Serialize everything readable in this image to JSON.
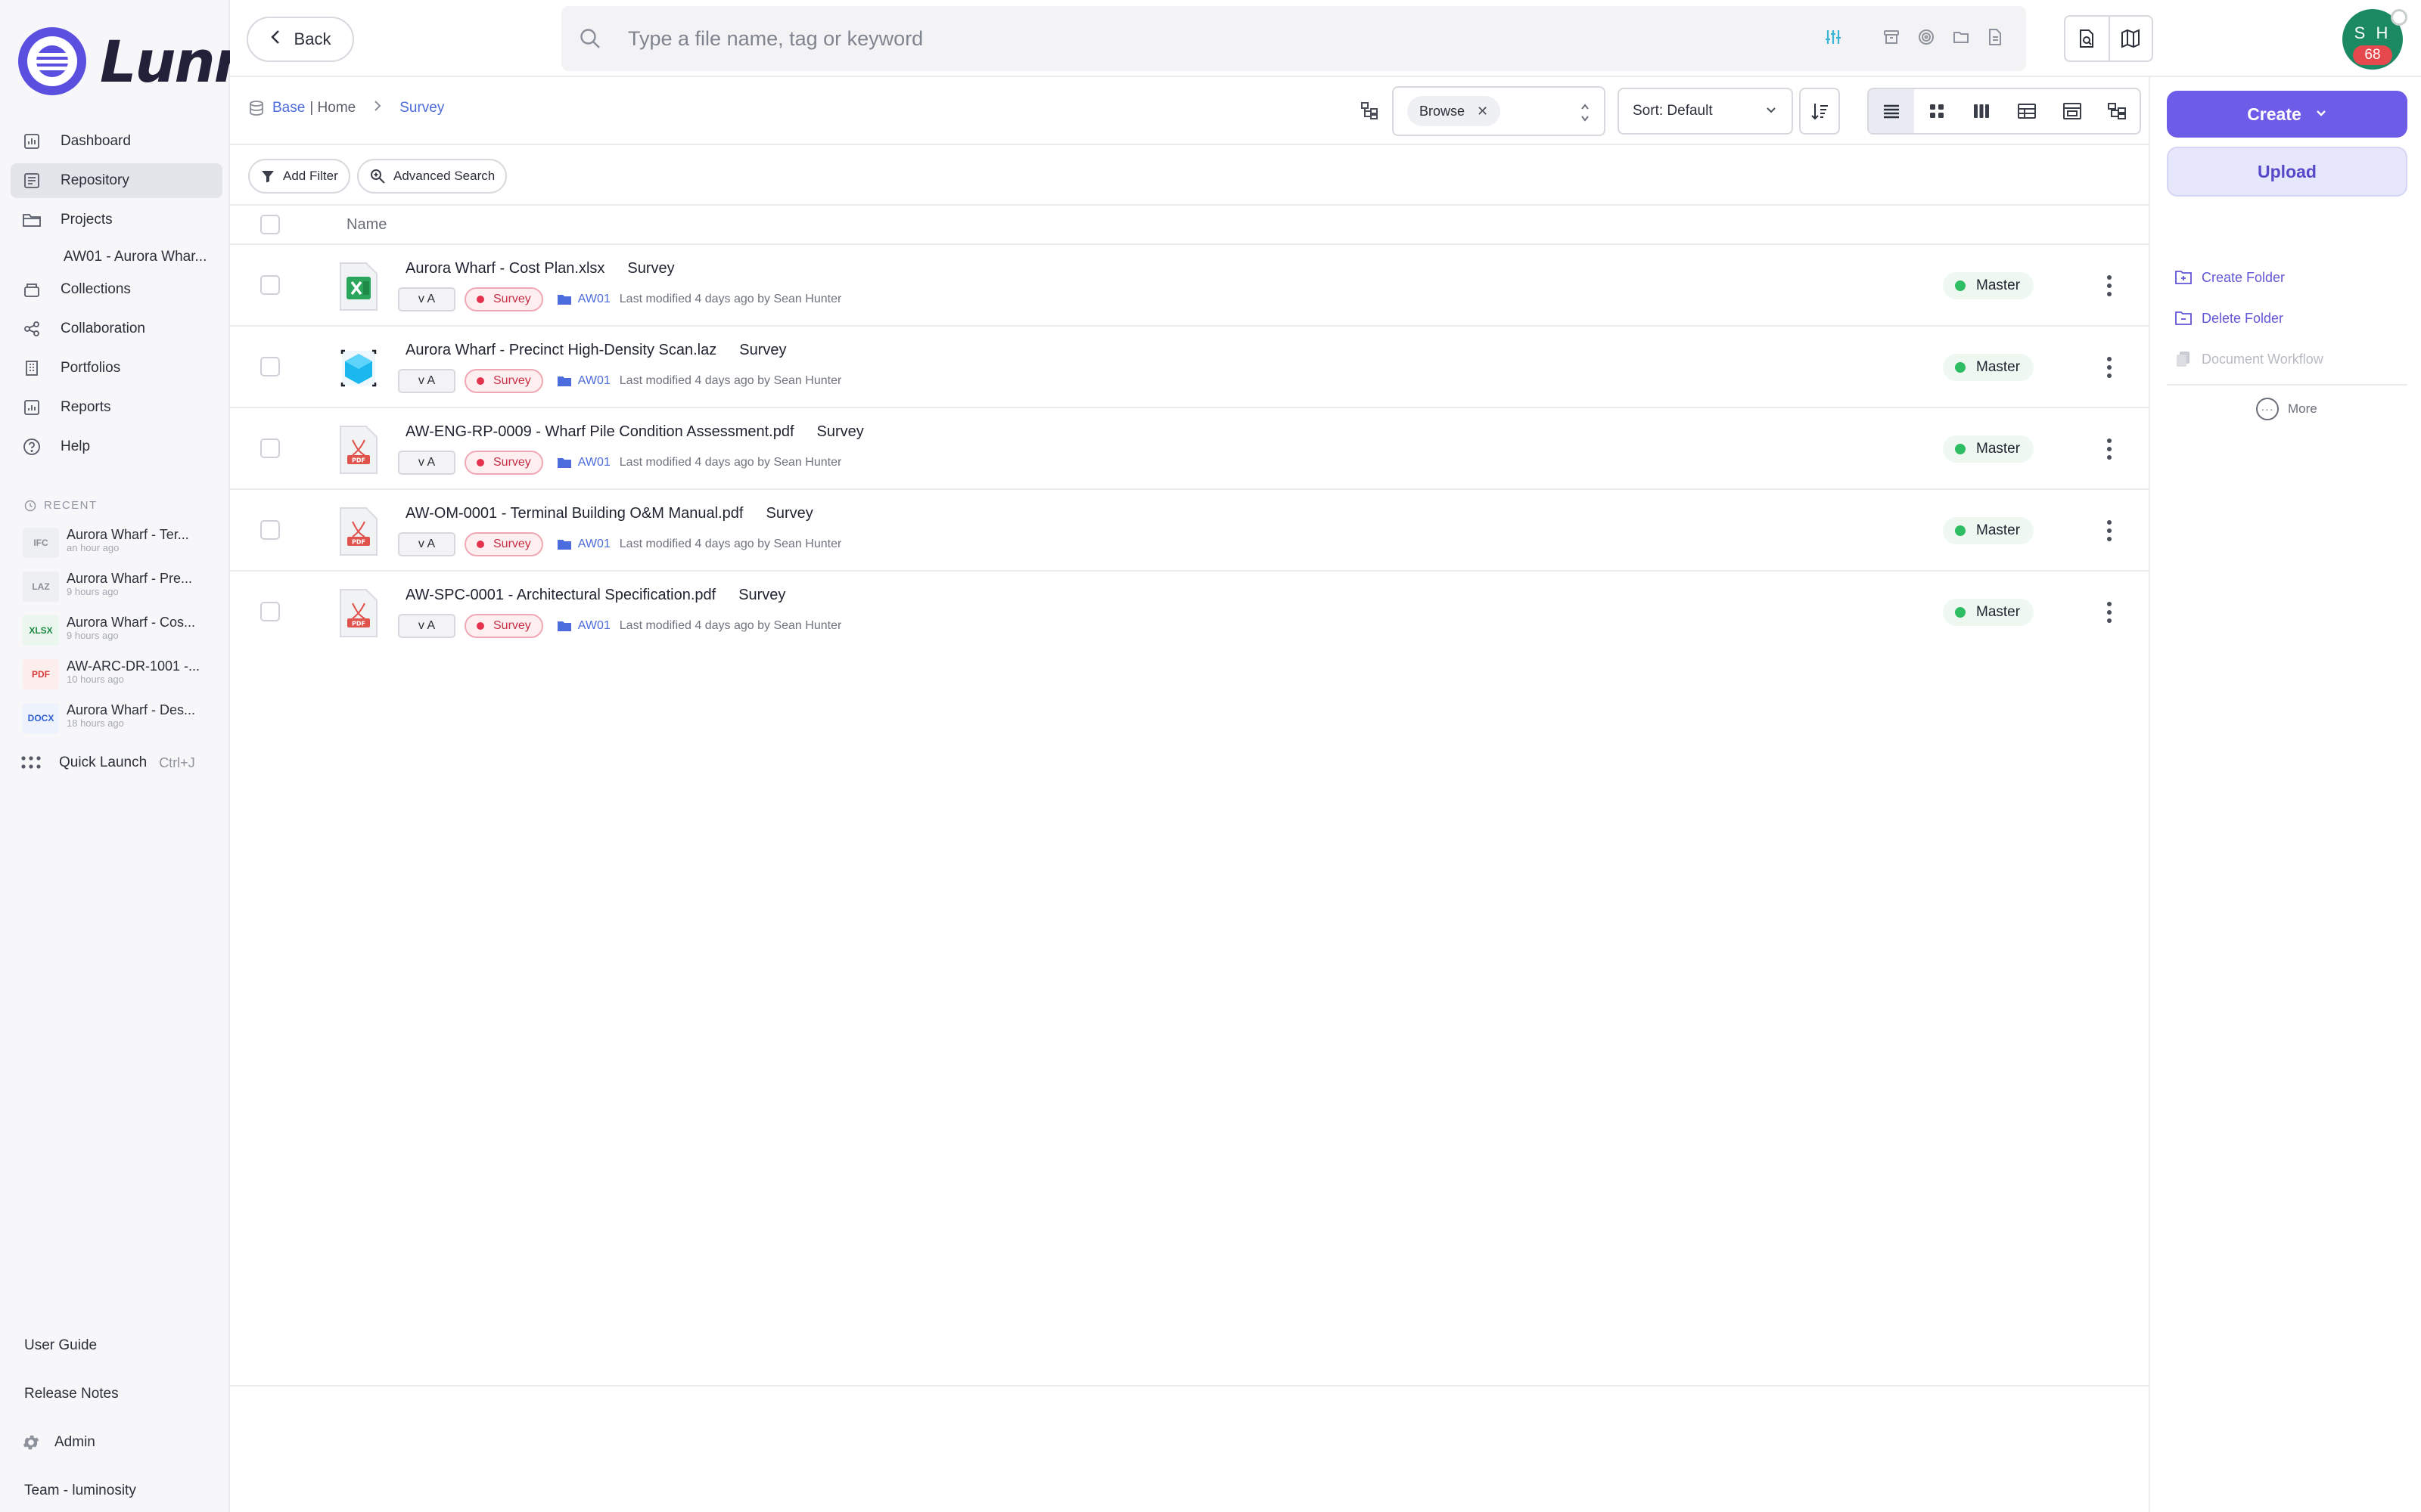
{
  "app": {
    "brand": "Lunr"
  },
  "sidebar": {
    "nav": [
      {
        "label": "Dashboard",
        "icon": "chart-icon"
      },
      {
        "label": "Repository",
        "icon": "repository-icon"
      },
      {
        "label": "Projects",
        "icon": "folder-icon"
      },
      {
        "label": "AW01 - Aurora Whar..."
      },
      {
        "label": "Collections",
        "icon": "collections-icon"
      },
      {
        "label": "Collaboration",
        "icon": "share-icon"
      },
      {
        "label": "Portfolios",
        "icon": "building-icon"
      },
      {
        "label": "Reports",
        "icon": "report-icon"
      },
      {
        "label": "Help",
        "icon": "help-icon"
      }
    ],
    "recent_label": "RECENT",
    "recent": [
      {
        "type": "IFC",
        "name": "Aurora Wharf - Ter...",
        "time": "an hour ago"
      },
      {
        "type": "LAZ",
        "name": "Aurora Wharf - Pre...",
        "time": "9 hours ago"
      },
      {
        "type": "XLSX",
        "name": "Aurora Wharf - Cos...",
        "time": "9 hours ago"
      },
      {
        "type": "PDF",
        "name": "AW-ARC-DR-1001 -...",
        "time": "10 hours ago"
      },
      {
        "type": "DOCX",
        "name": "Aurora Wharf - Des...",
        "time": "18 hours ago"
      }
    ],
    "quick_launch": {
      "label": "Quick Launch",
      "shortcut": "Ctrl+J"
    },
    "bottom": [
      {
        "label": "User Guide"
      },
      {
        "label": "Release Notes"
      },
      {
        "label": "Admin"
      },
      {
        "label": "Team - luminosity"
      }
    ]
  },
  "topbar": {
    "back_label": "Back",
    "search_placeholder": "Type a file name, tag or keyword",
    "avatar_initials": "S H",
    "avatar_badge": "68"
  },
  "toolbar": {
    "breadcrumb": {
      "base": "Base",
      "home": "| Home",
      "current": "Survey"
    },
    "browse_chip": "Browse",
    "sort_label": "Sort: Default"
  },
  "filters": {
    "add_filter": "Add Filter",
    "advanced_search": "Advanced Search"
  },
  "table": {
    "header_name": "Name",
    "rows": [
      {
        "name": "Aurora Wharf - Cost Plan.xlsx",
        "tag": "Survey",
        "version": "v A",
        "label": "Survey",
        "folder": "AW01",
        "modified": "Last modified 4 days ago by Sean Hunter",
        "status": "Master",
        "filetype": "xlsx"
      },
      {
        "name": "Aurora Wharf - Precinct High-Density Scan.laz",
        "tag": "Survey",
        "version": "v A",
        "label": "Survey",
        "folder": "AW01",
        "modified": "Last modified 4 days ago by Sean Hunter",
        "status": "Master",
        "filetype": "laz"
      },
      {
        "name": "AW-ENG-RP-0009 - Wharf Pile Condition Assessment.pdf",
        "tag": "Survey",
        "version": "v A",
        "label": "Survey",
        "folder": "AW01",
        "modified": "Last modified 4 days ago by Sean Hunter",
        "status": "Master",
        "filetype": "pdf"
      },
      {
        "name": "AW-OM-0001 - Terminal Building O&M Manual.pdf",
        "tag": "Survey",
        "version": "v A",
        "label": "Survey",
        "folder": "AW01",
        "modified": "Last modified 4 days ago by Sean Hunter",
        "status": "Master",
        "filetype": "pdf"
      },
      {
        "name": "AW-SPC-0001 - Architectural Specification.pdf",
        "tag": "Survey",
        "version": "v A",
        "label": "Survey",
        "folder": "AW01",
        "modified": "Last modified 4 days ago by Sean Hunter",
        "status": "Master",
        "filetype": "pdf"
      }
    ]
  },
  "right_panel": {
    "create_label": "Create",
    "upload_label": "Upload",
    "actions": [
      {
        "label": "Create Folder",
        "enabled": true
      },
      {
        "label": "Delete Folder",
        "enabled": true
      },
      {
        "label": "Document Workflow",
        "enabled": false
      }
    ],
    "more_label": "More"
  },
  "colors": {
    "accent": "#6c5ce7",
    "link": "#4c6bdc",
    "survey_tag": "#c72f45",
    "status_ok": "#2ebd63",
    "avatar": "#1b8a63"
  }
}
